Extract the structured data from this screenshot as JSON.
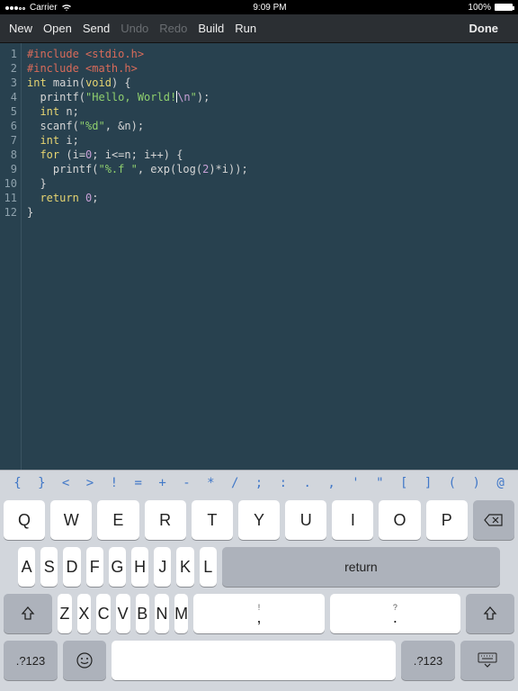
{
  "status": {
    "carrier": "Carrier",
    "time": "9:09 PM",
    "pct": "100%"
  },
  "toolbar": {
    "new": "New",
    "open": "Open",
    "send": "Send",
    "undo": "Undo",
    "redo": "Redo",
    "build": "Build",
    "run": "Run",
    "done": "Done"
  },
  "code_lines_count": 12,
  "symbols": [
    "{",
    "}",
    "<",
    ">",
    "!",
    "=",
    "+",
    "-",
    "*",
    "/",
    ";",
    ":",
    ".",
    ",",
    "'",
    "\"",
    "[",
    "]",
    "(",
    ")",
    "@"
  ],
  "keys": {
    "row1": [
      "Q",
      "W",
      "E",
      "R",
      "T",
      "Y",
      "U",
      "I",
      "O",
      "P"
    ],
    "row2": [
      "A",
      "S",
      "D",
      "F",
      "G",
      "H",
      "J",
      "K",
      "L"
    ],
    "row3": [
      "Z",
      "X",
      "C",
      "V",
      "B",
      "N",
      "M"
    ],
    "punct1_top": "!",
    "punct1_bot": ",",
    "punct2_top": "?",
    "punct2_bot": ".",
    "return": "return",
    "mode": ".?123"
  }
}
